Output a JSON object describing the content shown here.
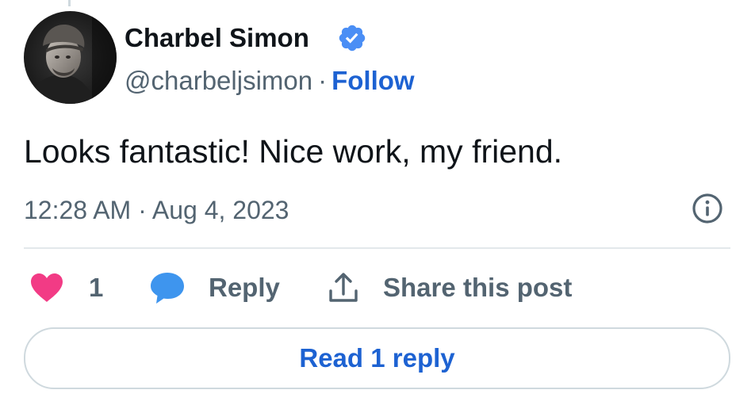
{
  "author": {
    "display_name": "Charbel Simon",
    "handle": "@charbeljsimon",
    "separator": "·",
    "follow_label": "Follow",
    "verified": true,
    "verified_color": "#4a8ef5"
  },
  "tweet": {
    "text": "Looks fantastic! Nice work, my friend.",
    "timestamp": "12:28 AM · Aug 4, 2023"
  },
  "actions": {
    "like_count": "1",
    "like_icon": "heart-icon",
    "like_color": "#f23b85",
    "reply_label": "Reply",
    "reply_icon": "speech-bubble-icon",
    "reply_color": "#3e95ee",
    "share_label": "Share this post",
    "share_icon": "share-upload-icon"
  },
  "footer": {
    "read_replies_label": "Read 1 reply"
  },
  "colors": {
    "link": "#1d62d2",
    "secondary_text": "#536471",
    "primary_text": "#0f1419",
    "border": "#cfd9de"
  }
}
